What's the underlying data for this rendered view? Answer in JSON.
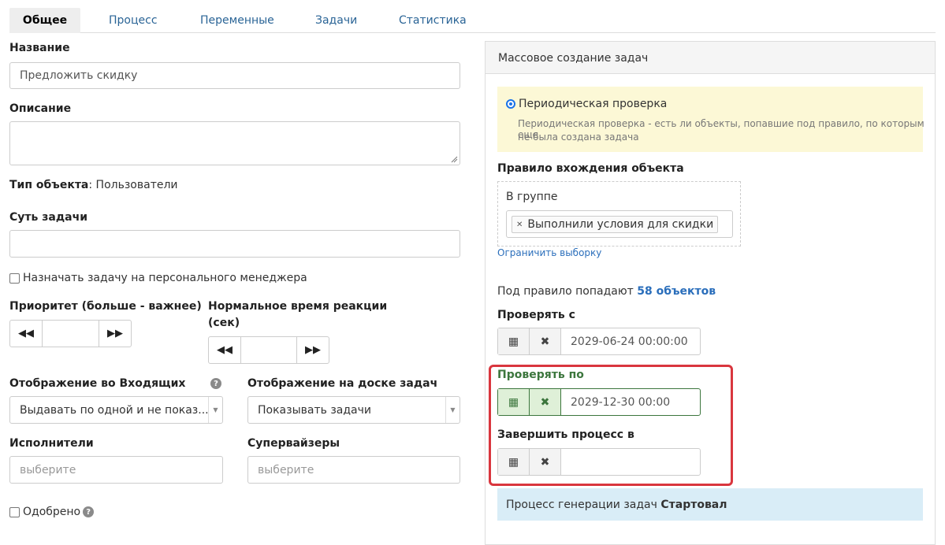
{
  "tabs": [
    {
      "label": "Общее",
      "active": true
    },
    {
      "label": "Процесс",
      "active": false
    },
    {
      "label": "Переменные",
      "active": false
    },
    {
      "label": "Задачи",
      "active": false
    },
    {
      "label": "Статистика",
      "active": false
    }
  ],
  "form": {
    "name_label": "Название",
    "name_value": "Предложить скидку",
    "description_label": "Описание",
    "object_type_label": "Тип объекта",
    "object_type_value": ": Пользователи",
    "task_essence_label": "Суть задачи",
    "assign_manager_label": "Назначать задачу на персонального менеджера",
    "priority_label": "Приоритет (больше - важнее)",
    "reaction_time_label_1": "Нормальное время реакции",
    "reaction_time_label_2": "(сек)",
    "inbox_display_label": "Отображение во Входящих",
    "inbox_display_value": "Выдавать по одной и не показ...",
    "board_display_label": "Отображение на доске задач",
    "board_display_value": "Показывать задачи",
    "executors_label": "Исполнители",
    "executors_placeholder": "выберите",
    "supervisors_label": "Супервайзеры",
    "supervisors_placeholder": "выберите",
    "approved_label": "Одобрено"
  },
  "panel": {
    "title": "Массовое создание задач",
    "periodic_check_label": "Периодическая проверка",
    "periodic_check_desc_1": "Периодическая проверка - есть ли объекты, попавшие под правило, по которым еще",
    "periodic_check_desc_2": "не была создана задача",
    "rule_label": "Правило вхождения объекта",
    "in_group_label": "В группе",
    "group_tag": "Выполнили условия для скидки",
    "limit_link": "Ограничить выборку",
    "match_prefix": "Под правило попадают",
    "match_count": "58 объектов",
    "check_from_label": "Проверять с",
    "check_from_value": "2029-06-24 00:00:00",
    "check_to_label": "Проверять по",
    "check_to_value": "2029-12-30 00:00",
    "finish_label": "Завершить процесс в",
    "finish_value": "",
    "status_prefix": "Процесс генерации задач",
    "status_value": "Стартовал"
  },
  "colors": {
    "link": "#2a6496",
    "success": "#3c763d",
    "highlight": "#d9363e",
    "info_bg": "#d9edf7",
    "warning_bg": "#fcf8d6"
  }
}
